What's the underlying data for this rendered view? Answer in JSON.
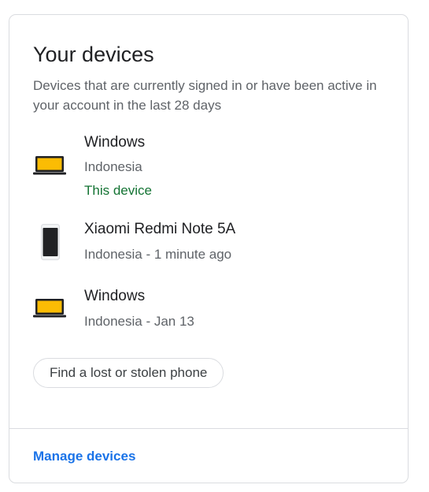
{
  "card": {
    "title": "Your devices",
    "subtitle": "Devices that are currently signed in or have been active in your account in the last 28 days"
  },
  "devices": [
    {
      "name": "Windows",
      "location": "Indonesia",
      "status": "This device",
      "icon": "laptop-icon"
    },
    {
      "name": "Xiaomi Redmi Note 5A",
      "location": "Indonesia - 1 minute ago",
      "icon": "phone-icon"
    },
    {
      "name": "Windows",
      "location": "Indonesia - Jan 13",
      "icon": "laptop-icon"
    }
  ],
  "actions": {
    "find_phone_label": "Find a lost or stolen phone",
    "manage_devices_label": "Manage devices"
  },
  "colors": {
    "accent": "#1a73e8",
    "this_device": "#137333",
    "laptop_screen": "#fbbc04"
  }
}
